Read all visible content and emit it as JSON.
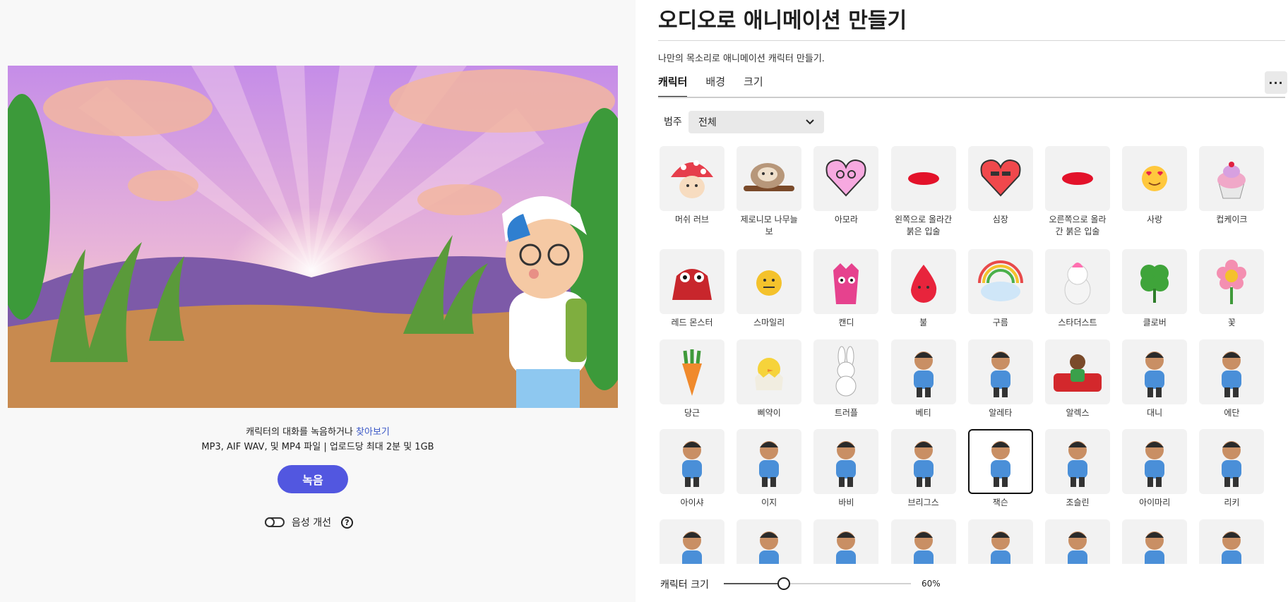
{
  "editor": {
    "title": "오디오로 애니메이션 만들기",
    "subtitle": "나만의 목소리로 애니메이션 캐릭터 만들기.",
    "tabs": [
      "캐릭터",
      "배경",
      "크기"
    ],
    "more_label": "···",
    "category_label": "범주",
    "category_value": "전체",
    "size_label": "캐릭터 크기",
    "size_value": "60%",
    "size_fraction": 0.32
  },
  "preview": {
    "record_hint": "캐릭터의 대화를 녹음하거나",
    "browse_link": "찾아보기",
    "file_hint": "MP3, AIF WAV, 및 MP4 파일 | 업로드당 최대 2분 및 1GB",
    "record_button": "녹음",
    "enhance_label": "음성 개선",
    "help_label": "?"
  },
  "characters": [
    {
      "name": "머쉬 러브",
      "icon": "mushroom"
    },
    {
      "name": "제로니모 나무늘보",
      "icon": "sloth"
    },
    {
      "name": "아모라",
      "icon": "pink-heart"
    },
    {
      "name": "왼쪽으로 올라간 붉은 입술",
      "icon": "lips"
    },
    {
      "name": "심장",
      "icon": "red-heart"
    },
    {
      "name": "오른쪽으로 올라간 붉은 입술",
      "icon": "lips"
    },
    {
      "name": "사랑",
      "icon": "love-emoji"
    },
    {
      "name": "컵케이크",
      "icon": "cupcake"
    },
    {
      "name": "레드 몬스터",
      "icon": "red-monster"
    },
    {
      "name": "스마일리",
      "icon": "smiley"
    },
    {
      "name": "캔디",
      "icon": "candy"
    },
    {
      "name": "불",
      "icon": "fire"
    },
    {
      "name": "구름",
      "icon": "cloud"
    },
    {
      "name": "스타더스트",
      "icon": "unicorn"
    },
    {
      "name": "클로버",
      "icon": "clover"
    },
    {
      "name": "꽃",
      "icon": "flower"
    },
    {
      "name": "당근",
      "icon": "carrot"
    },
    {
      "name": "삐약이",
      "icon": "chick"
    },
    {
      "name": "트러플",
      "icon": "bunny"
    },
    {
      "name": "베티",
      "icon": "person"
    },
    {
      "name": "알레타",
      "icon": "person"
    },
    {
      "name": "알렉스",
      "icon": "person-couch"
    },
    {
      "name": "대니",
      "icon": "person"
    },
    {
      "name": "에단",
      "icon": "person"
    },
    {
      "name": "아이샤",
      "icon": "person"
    },
    {
      "name": "이지",
      "icon": "person"
    },
    {
      "name": "바비",
      "icon": "person"
    },
    {
      "name": "브리그스",
      "icon": "person"
    },
    {
      "name": "잭슨",
      "icon": "person",
      "selected": true
    },
    {
      "name": "조슬린",
      "icon": "person"
    },
    {
      "name": "아이마리",
      "icon": "person"
    },
    {
      "name": "리키",
      "icon": "person"
    },
    {
      "name": "",
      "icon": "person"
    },
    {
      "name": "",
      "icon": "person"
    },
    {
      "name": "",
      "icon": "person"
    },
    {
      "name": "",
      "icon": "person"
    },
    {
      "name": "",
      "icon": "person"
    },
    {
      "name": "",
      "icon": "person"
    },
    {
      "name": "",
      "icon": "person"
    },
    {
      "name": "",
      "icon": "person"
    }
  ]
}
